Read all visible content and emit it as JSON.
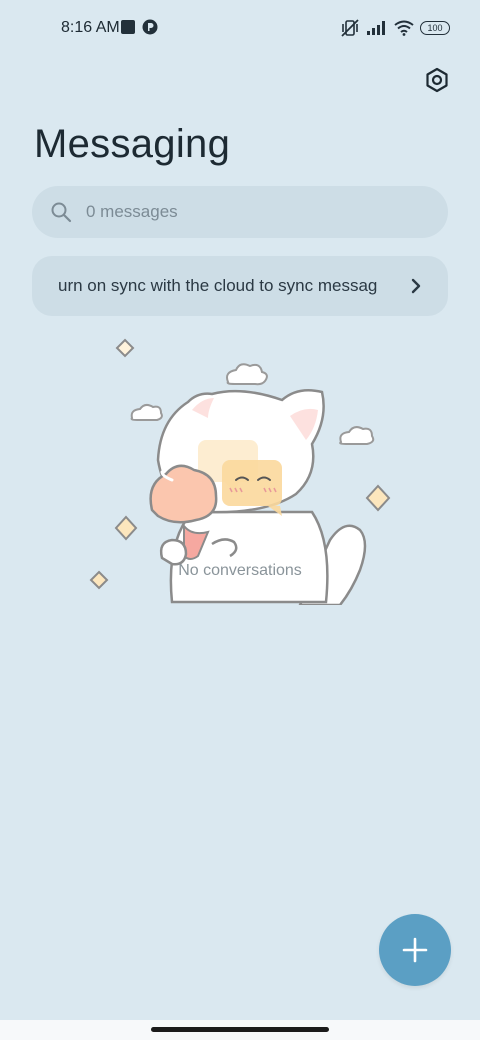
{
  "status_bar": {
    "time": "8:16 AM",
    "battery": "100",
    "icons": [
      "notification-square-icon",
      "app-notification-icon",
      "mute-vibrate-icon",
      "signal-icon",
      "wifi-icon",
      "battery-icon"
    ]
  },
  "header": {
    "title": "Messaging",
    "settings_icon": "settings-hexagon-icon"
  },
  "search": {
    "placeholder": "0 messages",
    "icon": "search-icon"
  },
  "sync_banner": {
    "text": "urn on sync with the cloud to sync messag",
    "icon": "chevron-right-icon"
  },
  "empty_state": {
    "label": "No conversations",
    "illustration": "cat-with-ice-cream-illustration"
  },
  "fab": {
    "icon": "plus-icon"
  },
  "colors": {
    "background": "#dae8f0",
    "surface": "#cddde6",
    "accent": "#5b9fc4"
  }
}
